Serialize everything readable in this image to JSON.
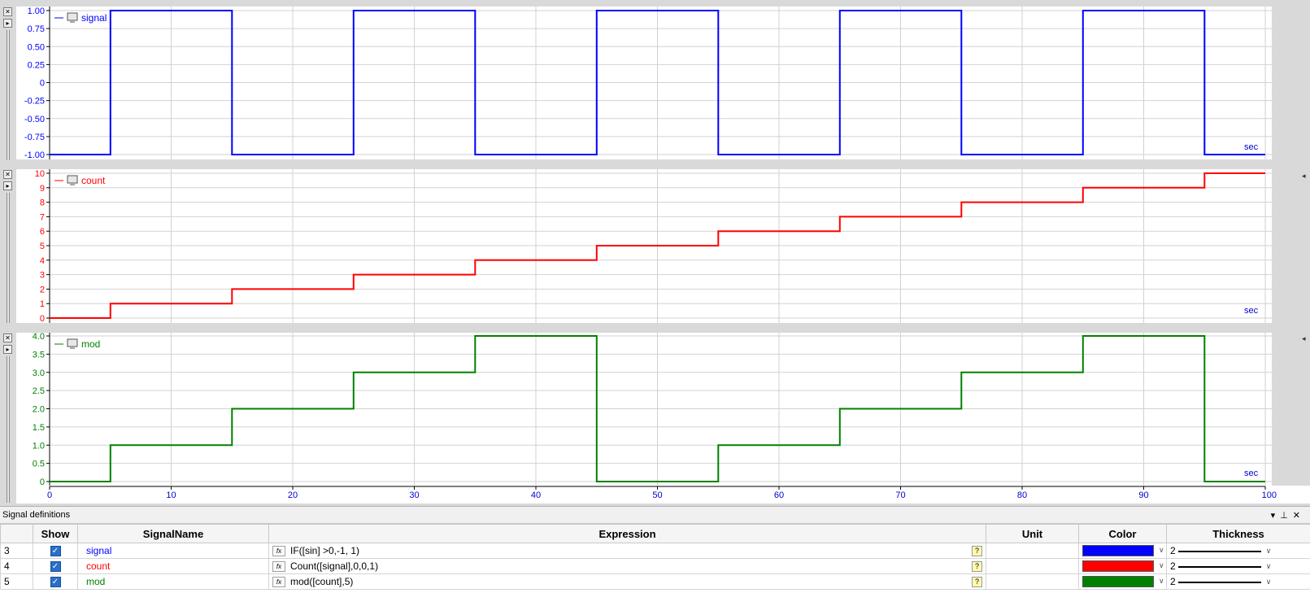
{
  "panels": [
    {
      "name": "signal",
      "color": "#0000ff",
      "ticks": [
        {
          "v": 1.0,
          "label": "1.00"
        },
        {
          "v": 0.75,
          "label": "0.75"
        },
        {
          "v": 0.5,
          "label": "0.50"
        },
        {
          "v": 0.25,
          "label": "0.25"
        },
        {
          "v": 0,
          "label": "0"
        },
        {
          "v": -0.25,
          "label": "-0.25"
        },
        {
          "v": -0.5,
          "label": "-0.50"
        },
        {
          "v": -0.75,
          "label": "-0.75"
        },
        {
          "v": -1.0,
          "label": "-1.00"
        }
      ],
      "unit": "sec"
    },
    {
      "name": "count",
      "color": "#ff0000",
      "ticks": [
        {
          "v": 10,
          "label": "10"
        },
        {
          "v": 9,
          "label": "9"
        },
        {
          "v": 8,
          "label": "8"
        },
        {
          "v": 7,
          "label": "7"
        },
        {
          "v": 6,
          "label": "6"
        },
        {
          "v": 5,
          "label": "5"
        },
        {
          "v": 4,
          "label": "4"
        },
        {
          "v": 3,
          "label": "3"
        },
        {
          "v": 2,
          "label": "2"
        },
        {
          "v": 1,
          "label": "1"
        },
        {
          "v": 0,
          "label": "0"
        }
      ],
      "unit": "sec"
    },
    {
      "name": "mod",
      "color": "#008000",
      "ticks": [
        {
          "v": 4.0,
          "label": "4.0"
        },
        {
          "v": 3.5,
          "label": "3.5"
        },
        {
          "v": 3.0,
          "label": "3.0"
        },
        {
          "v": 2.5,
          "label": "2.5"
        },
        {
          "v": 2.0,
          "label": "2.0"
        },
        {
          "v": 1.5,
          "label": "1.5"
        },
        {
          "v": 1.0,
          "label": "1.0"
        },
        {
          "v": 0.5,
          "label": "0.5"
        },
        {
          "v": 0,
          "label": "0"
        }
      ],
      "unit": "sec"
    }
  ],
  "x_ticks": [
    "0",
    "10",
    "20",
    "30",
    "40",
    "50",
    "60",
    "70",
    "80",
    "90",
    "100"
  ],
  "chart_data": [
    {
      "type": "line",
      "series": [
        {
          "name": "signal",
          "color": "#0000ff",
          "x": [
            0,
            5,
            5,
            15,
            15,
            25,
            25,
            35,
            35,
            45,
            45,
            55,
            55,
            65,
            65,
            75,
            75,
            85,
            85,
            95,
            95,
            100
          ],
          "y": [
            -1,
            -1,
            1,
            1,
            -1,
            -1,
            1,
            1,
            -1,
            -1,
            1,
            1,
            -1,
            -1,
            1,
            1,
            -1,
            -1,
            1,
            1,
            -1,
            -1
          ]
        }
      ],
      "xlim": [
        0,
        100
      ],
      "ylim": [
        -1,
        1
      ],
      "grid": true,
      "legend": "top-left"
    },
    {
      "type": "line",
      "series": [
        {
          "name": "count",
          "color": "#ff0000",
          "x": [
            0,
            5,
            5,
            15,
            15,
            25,
            25,
            35,
            35,
            45,
            45,
            55,
            55,
            65,
            65,
            75,
            75,
            85,
            85,
            95,
            95,
            100
          ],
          "y": [
            0,
            0,
            1,
            1,
            2,
            2,
            3,
            3,
            4,
            4,
            5,
            5,
            6,
            6,
            7,
            7,
            8,
            8,
            9,
            9,
            10,
            10
          ]
        }
      ],
      "xlim": [
        0,
        100
      ],
      "ylim": [
        0,
        10
      ],
      "grid": true,
      "legend": "top-left"
    },
    {
      "type": "line",
      "series": [
        {
          "name": "mod",
          "color": "#008000",
          "x": [
            0,
            5,
            5,
            15,
            15,
            25,
            25,
            35,
            35,
            45,
            45,
            55,
            55,
            65,
            65,
            75,
            75,
            85,
            85,
            95,
            95,
            100
          ],
          "y": [
            0,
            0,
            1,
            1,
            2,
            2,
            3,
            3,
            4,
            4,
            0,
            0,
            1,
            1,
            2,
            2,
            3,
            3,
            4,
            4,
            0,
            0
          ]
        }
      ],
      "xlim": [
        0,
        100
      ],
      "ylim": [
        0,
        4
      ],
      "grid": true,
      "legend": "top-left"
    }
  ],
  "signal_definitions": {
    "title": "Signal definitions",
    "columns": {
      "show": "Show",
      "name": "SignalName",
      "expression": "Expression",
      "unit": "Unit",
      "color": "Color",
      "thickness": "Thickness"
    },
    "rows": [
      {
        "index": "3",
        "name": "signal",
        "expression": "IF([sin] >0,-1, 1)",
        "unit": "",
        "color": "#0000ff",
        "thickness": "2"
      },
      {
        "index": "4",
        "name": "count",
        "expression": "Count([signal],0,0,1)",
        "unit": "",
        "color": "#ff0000",
        "thickness": "2"
      },
      {
        "index": "5",
        "name": "mod",
        "expression": "mod([count],5)",
        "unit": "",
        "color": "#008000",
        "thickness": "2"
      }
    ]
  }
}
